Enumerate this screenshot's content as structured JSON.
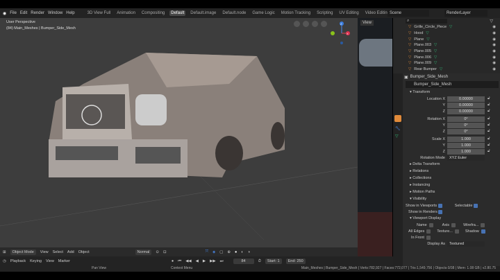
{
  "menu": {
    "items": [
      "File",
      "Edit",
      "Render",
      "Window",
      "Help"
    ],
    "workspaces": [
      "3D View Full",
      "Animation",
      "Compositing",
      "Default",
      "Default.image",
      "Default.node",
      "Game Logic",
      "Motion Tracking",
      "Scripting",
      "UV Editing",
      "Video Editing"
    ],
    "active_workspace": "Default",
    "add_label": "+",
    "scene": "Scene",
    "render_layer": "RenderLayer"
  },
  "viewport": {
    "perspective": "User Perspective",
    "object_info": "(84) Main_Meshes | Bumper_Side_Mesh",
    "gizmo": {
      "z": "Z",
      "x": "X",
      "y": "Y"
    },
    "footer": {
      "mode": "Object Mode",
      "menus": [
        "View",
        "Select",
        "Add",
        "Object"
      ],
      "orientation": "Normal"
    }
  },
  "image_editor": {
    "view_label": "View"
  },
  "outliner": {
    "items": [
      "Grille_Circle_Piece",
      "Hood",
      "Plane",
      "Plane.003",
      "Plane.005",
      "Plane.006",
      "Plane.009",
      "Rear Bumper"
    ]
  },
  "properties": {
    "object_name": "Bumper_Side_Mesh",
    "data_name": "Bumper_Side_Mesh",
    "transform_label": "Transform",
    "rows": [
      {
        "label": "Location X",
        "value": "0.00000"
      },
      {
        "label": "Y",
        "value": "0.00000"
      },
      {
        "label": "Z",
        "value": "0.00000"
      },
      {
        "label": "Rotation X",
        "value": "0°"
      },
      {
        "label": "Y",
        "value": "0°"
      },
      {
        "label": "Z",
        "value": "0°"
      },
      {
        "label": "Scale X",
        "value": "1.000"
      },
      {
        "label": "Y",
        "value": "1.000"
      },
      {
        "label": "Z",
        "value": "1.000"
      }
    ],
    "rotation_mode_label": "Rotation Mode",
    "rotation_mode": "XYZ Euler",
    "sections": [
      "Delta Transform",
      "Relations",
      "Collections",
      "Instancing",
      "Motion Paths"
    ],
    "visibility_label": "Visibility",
    "show_viewports": "Show in Viewports",
    "selectable": "Selectable",
    "show_renders": "Show in Renders",
    "viewport_display_label": "Viewport Display",
    "name": "Name",
    "axis": "Axis",
    "wireframe": "Wirefra...",
    "all_edges": "All Edges",
    "texture": "Texture...",
    "shadow": "Shadow",
    "in_front": "In Front",
    "display_as_label": "Display As",
    "display_as": "Textured"
  },
  "timeline": {
    "menus": [
      "Playback",
      "Keying",
      "View",
      "Marker"
    ],
    "frame": "84",
    "start_label": "Start:",
    "start": "1",
    "end_label": "End:",
    "end": "250"
  },
  "status": {
    "hints": [
      "Pan View",
      "Context Menu"
    ],
    "stats": "Main_Meshes | Bumper_Side_Mesh | Verts:782,927 | Faces:772,077 | Tris:1,549,756 | Objects:0/38 | Mem: 1.08 GB | v2.80.75"
  }
}
